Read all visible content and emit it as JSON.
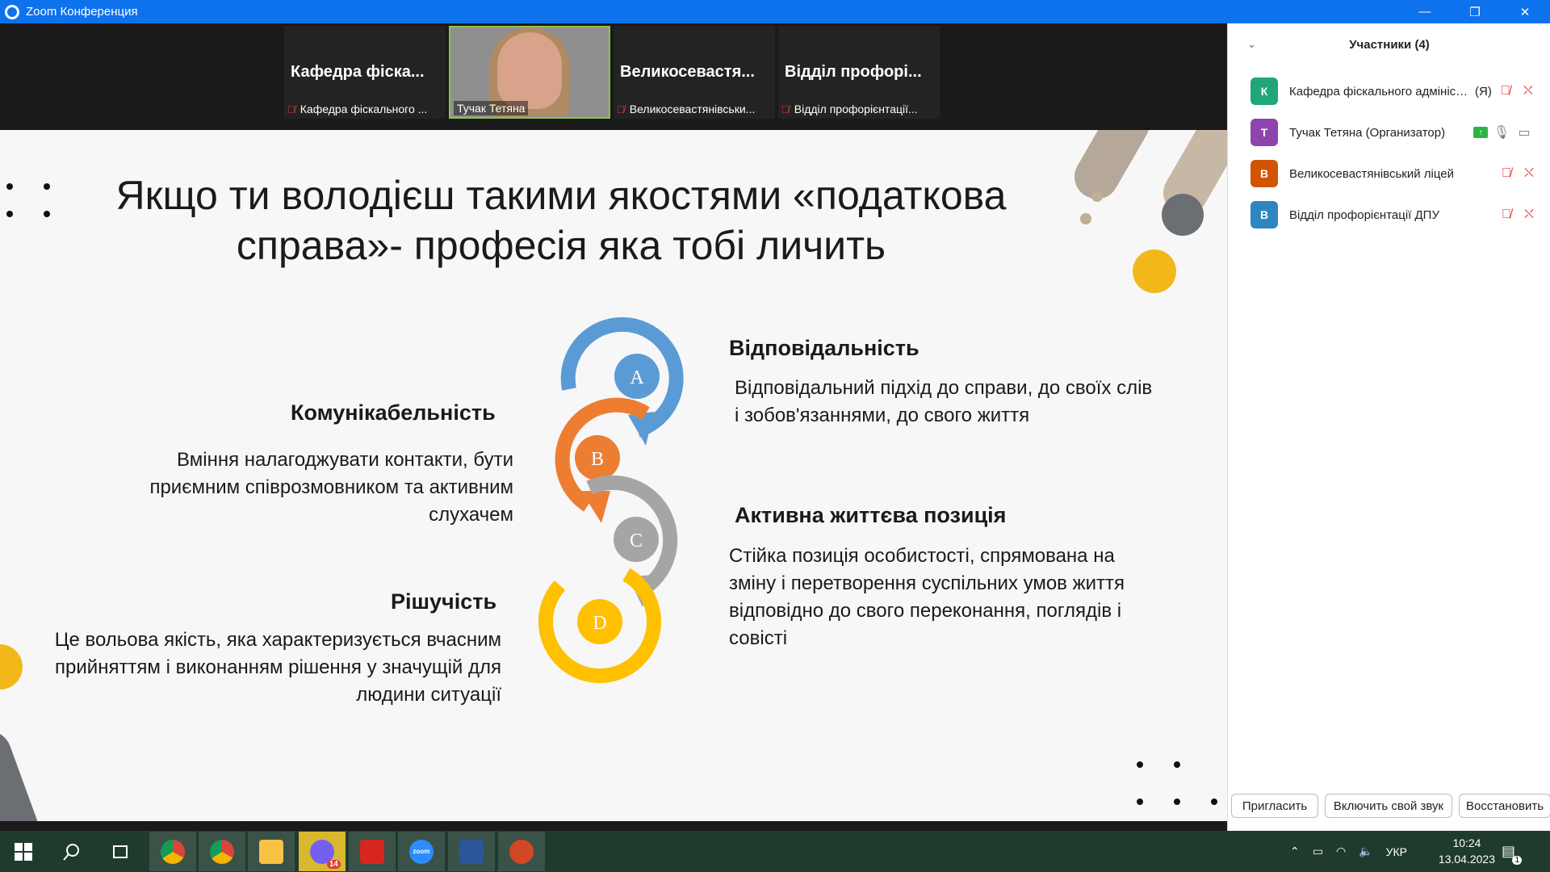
{
  "window": {
    "title": "Zoom Конференция",
    "minimize": "—",
    "restore": "❐",
    "close": "✕"
  },
  "video_strip": {
    "tiles": [
      {
        "big_name": "Кафедра фіска...",
        "small_name": "Кафедра фіскального ..."
      },
      {
        "small_name": "Тучак Тетяна"
      },
      {
        "big_name": "Великосевастя...",
        "small_name": "Великосевастянівськи..."
      },
      {
        "big_name": "Відділ профорі...",
        "small_name": "Відділ профорієнтації..."
      }
    ]
  },
  "slide": {
    "title_line1": "Якщо ти володієш такими якостями «податкова",
    "title_line2": "справа»- професія яка тобі личить",
    "cycle_letters": [
      "A",
      "B",
      "C",
      "D"
    ],
    "cycle_colors": [
      "#5b9bd5",
      "#ed7d31",
      "#a5a5a5",
      "#ffc000"
    ],
    "items": {
      "responsibility": {
        "heading": "Відповідальність",
        "text": "Відповідальний підхід до справи, до своїх слів і зобов'язаннями, до свого життя"
      },
      "sociability": {
        "heading": "Комунікабельність",
        "text": "Вміння налагоджувати контакти, бути приємним співрозмовником та активним слухачем"
      },
      "active_position": {
        "heading": "Активна життєва позиція",
        "text": "Стійка позиція особистості, спрямована на зміну і перетворення суспільних умов життя відповідно до свого переконання, поглядів і совісті"
      },
      "decisiveness": {
        "heading": "Рішучість",
        "text": "Це вольова якість, яка характеризується вчасним прийняттям і виконанням рішення у значущій для людини ситуації"
      }
    }
  },
  "participants_panel": {
    "header": "Участники (4)",
    "participants": [
      {
        "initial": "К",
        "name": "Кафедра фіскального адміністр...",
        "me": "(Я)",
        "color": "#1fa67a"
      },
      {
        "initial": "Т",
        "name": "Тучак Тетяна (Организатор)",
        "color": "#8e44ad"
      },
      {
        "initial": "В",
        "name": "Великосевастянівський ліцей",
        "color": "#d35400"
      },
      {
        "initial": "В",
        "name": "Відділ профорієнтації ДПУ",
        "color": "#2e86c1"
      }
    ],
    "buttons": {
      "invite": "Пригласить",
      "unmute_self": "Включить свой звук",
      "restore": "Восстановить"
    }
  },
  "taskbar": {
    "zoom_label": "zoom",
    "viber_badge": "14",
    "language": "УКР",
    "time": "10:24",
    "date": "13.04.2023",
    "notification_count": "1"
  }
}
